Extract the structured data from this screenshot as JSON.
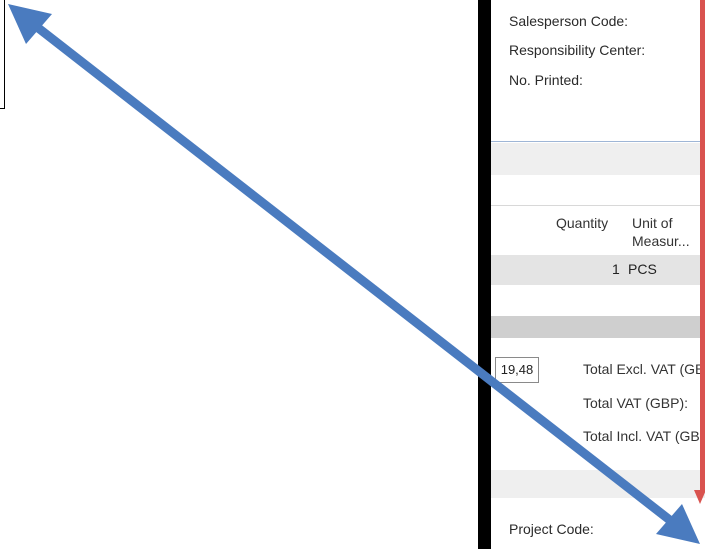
{
  "header_fields": {
    "salesperson_code": "Salesperson Code:",
    "responsibility_center": "Responsibility Center:",
    "no_printed": "No. Printed:"
  },
  "lines": {
    "columns": [
      "Quantity",
      "Unit of Measur..."
    ],
    "column_quantity": "Quantity",
    "column_uom_line1": "Unit of",
    "column_uom_line2": "Measur...",
    "row": {
      "quantity": "1",
      "unit": "PCS"
    }
  },
  "totals": {
    "amount": "19,48",
    "total_excl_vat": "Total Excl. VAT (GB",
    "total_vat": "Total VAT (GBP):",
    "total_incl_vat": "Total Incl. VAT (GB"
  },
  "footer_fields": {
    "project_code": "Project Code:"
  },
  "colors": {
    "annotation_arrow": "#4a7bbf",
    "highlight_edge": "#d9534f",
    "divider": "#000000"
  },
  "icons": {
    "annotation": "double-headed-arrow-icon"
  }
}
